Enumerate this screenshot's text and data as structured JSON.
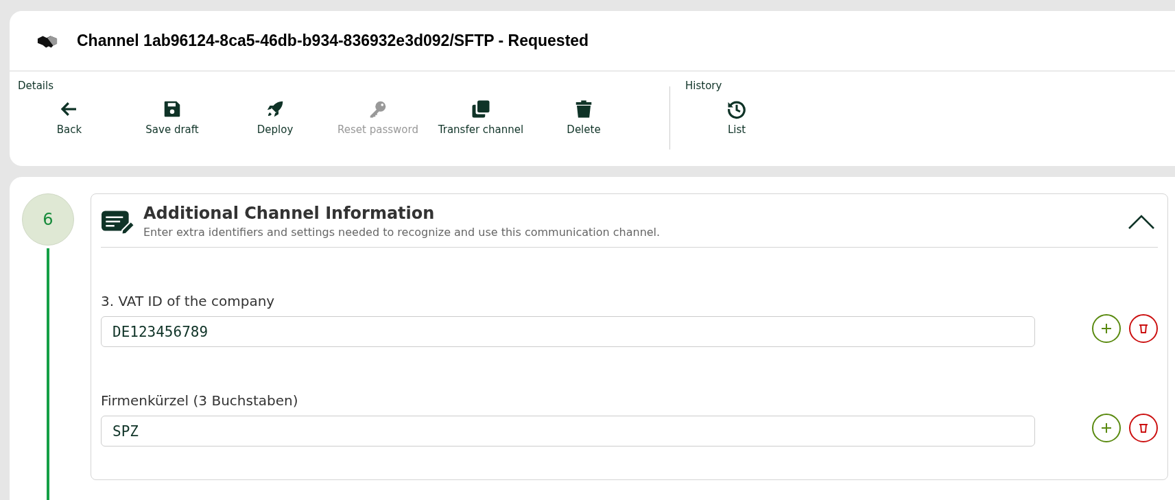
{
  "header": {
    "title": "Channel 1ab96124-8ca5-46db-b934-836932e3d092/SFTP - Requested"
  },
  "toolbar_groups": [
    {
      "label": "Details",
      "buttons": [
        {
          "kind": "back",
          "label": "Back",
          "disabled": false
        },
        {
          "kind": "save",
          "label": "Save draft",
          "disabled": false
        },
        {
          "kind": "deploy",
          "label": "Deploy",
          "disabled": false
        },
        {
          "kind": "key",
          "label": "Reset password",
          "disabled": true
        },
        {
          "kind": "transfer",
          "label": "Transfer channel",
          "disabled": false
        },
        {
          "kind": "delete",
          "label": "Delete",
          "disabled": false
        }
      ]
    },
    {
      "label": "History",
      "buttons": [
        {
          "kind": "history",
          "label": "List",
          "disabled": false
        }
      ]
    }
  ],
  "step": {
    "number": "6",
    "expanded": true,
    "title": "Additional Channel Information",
    "description": "Enter extra identifiers and settings needed to recognize and use this communication channel.",
    "fields": [
      {
        "label": "3. VAT ID of the company",
        "value": "DE123456789"
      },
      {
        "label": "Firmenkürzel (3 Buchstaben)",
        "value": "SPZ"
      }
    ]
  }
}
